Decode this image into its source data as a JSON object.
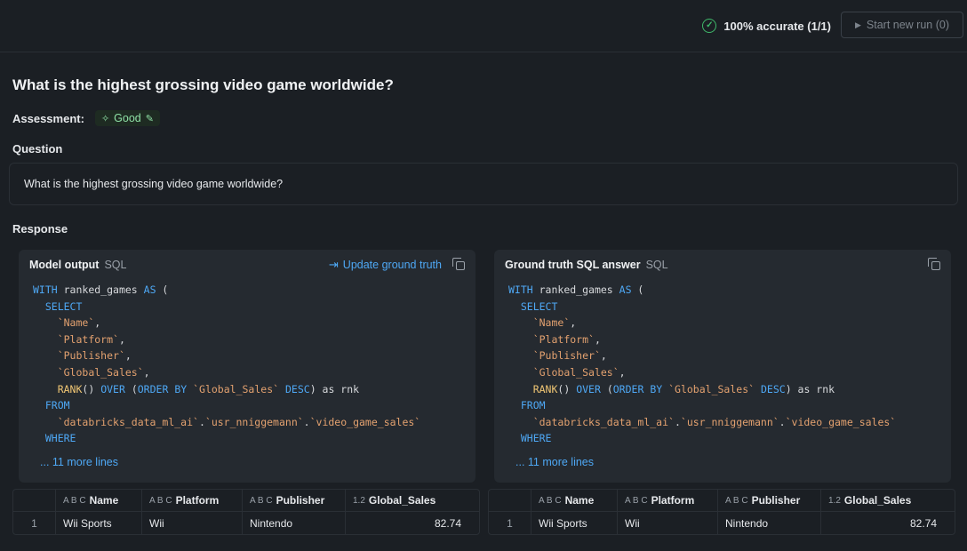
{
  "header": {
    "accuracy_text": "100% accurate (1/1)",
    "run_button_label": "Start new run (0)"
  },
  "page_title": "What is the highest grossing video game worldwide?",
  "assessment": {
    "label": "Assessment:",
    "value": "Good"
  },
  "question": {
    "label": "Question",
    "text": "What is the highest grossing video game worldwide?"
  },
  "response_label": "Response",
  "model_output": {
    "title": "Model output",
    "lang": "SQL",
    "update_label": "Update ground truth",
    "more_lines": "... 11 more lines"
  },
  "ground_truth": {
    "title": "Ground truth SQL answer",
    "lang": "SQL",
    "more_lines": "... 11 more lines"
  },
  "code_lines": [
    "WITH ranked_games AS (",
    "  SELECT",
    "    `Name`,",
    "    `Platform`,",
    "    `Publisher`,",
    "    `Global_Sales`,",
    "    RANK() OVER (ORDER BY `Global_Sales` DESC) as rnk",
    "  FROM",
    "    `databricks_data_ml_ai`.`usr_nniggemann`.`video_game_sales`",
    "  WHERE"
  ],
  "table": {
    "type_icons": {
      "text": "A B C",
      "number": "1.2"
    },
    "columns": [
      "Name",
      "Platform",
      "Publisher",
      "Global_Sales"
    ],
    "rows": [
      {
        "index": "1",
        "name": "Wii Sports",
        "platform": "Wii",
        "publisher": "Nintendo",
        "global_sales": "82.74"
      }
    ]
  },
  "colors": {
    "keyword": "#4ea8f5",
    "function": "#f0c674",
    "identifier": "#e3a16f",
    "success": "#3fb86a"
  }
}
